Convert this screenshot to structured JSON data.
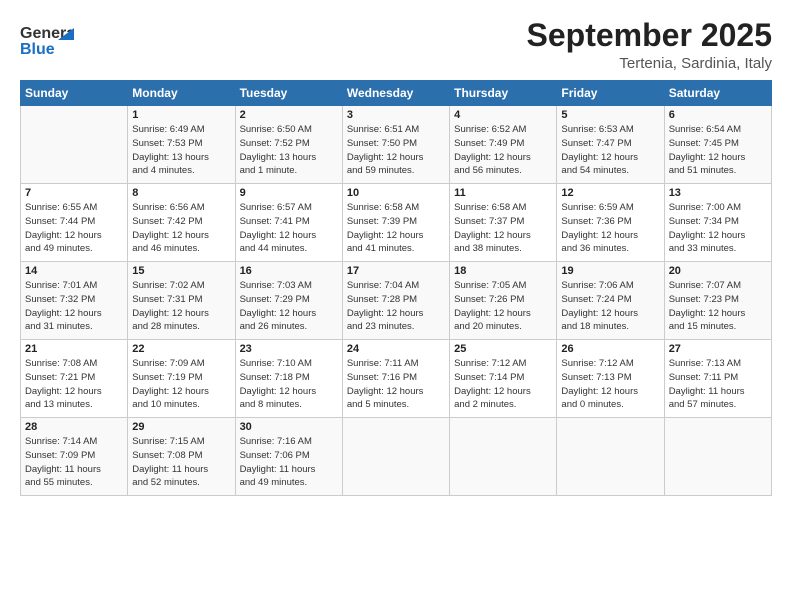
{
  "logo": {
    "line1": "General",
    "line2": "Blue"
  },
  "title": "September 2025",
  "subtitle": "Tertenia, Sardinia, Italy",
  "header_days": [
    "Sunday",
    "Monday",
    "Tuesday",
    "Wednesday",
    "Thursday",
    "Friday",
    "Saturday"
  ],
  "weeks": [
    [
      {
        "day": "",
        "info": ""
      },
      {
        "day": "1",
        "info": "Sunrise: 6:49 AM\nSunset: 7:53 PM\nDaylight: 13 hours\nand 4 minutes."
      },
      {
        "day": "2",
        "info": "Sunrise: 6:50 AM\nSunset: 7:52 PM\nDaylight: 13 hours\nand 1 minute."
      },
      {
        "day": "3",
        "info": "Sunrise: 6:51 AM\nSunset: 7:50 PM\nDaylight: 12 hours\nand 59 minutes."
      },
      {
        "day": "4",
        "info": "Sunrise: 6:52 AM\nSunset: 7:49 PM\nDaylight: 12 hours\nand 56 minutes."
      },
      {
        "day": "5",
        "info": "Sunrise: 6:53 AM\nSunset: 7:47 PM\nDaylight: 12 hours\nand 54 minutes."
      },
      {
        "day": "6",
        "info": "Sunrise: 6:54 AM\nSunset: 7:45 PM\nDaylight: 12 hours\nand 51 minutes."
      }
    ],
    [
      {
        "day": "7",
        "info": "Sunrise: 6:55 AM\nSunset: 7:44 PM\nDaylight: 12 hours\nand 49 minutes."
      },
      {
        "day": "8",
        "info": "Sunrise: 6:56 AM\nSunset: 7:42 PM\nDaylight: 12 hours\nand 46 minutes."
      },
      {
        "day": "9",
        "info": "Sunrise: 6:57 AM\nSunset: 7:41 PM\nDaylight: 12 hours\nand 44 minutes."
      },
      {
        "day": "10",
        "info": "Sunrise: 6:58 AM\nSunset: 7:39 PM\nDaylight: 12 hours\nand 41 minutes."
      },
      {
        "day": "11",
        "info": "Sunrise: 6:58 AM\nSunset: 7:37 PM\nDaylight: 12 hours\nand 38 minutes."
      },
      {
        "day": "12",
        "info": "Sunrise: 6:59 AM\nSunset: 7:36 PM\nDaylight: 12 hours\nand 36 minutes."
      },
      {
        "day": "13",
        "info": "Sunrise: 7:00 AM\nSunset: 7:34 PM\nDaylight: 12 hours\nand 33 minutes."
      }
    ],
    [
      {
        "day": "14",
        "info": "Sunrise: 7:01 AM\nSunset: 7:32 PM\nDaylight: 12 hours\nand 31 minutes."
      },
      {
        "day": "15",
        "info": "Sunrise: 7:02 AM\nSunset: 7:31 PM\nDaylight: 12 hours\nand 28 minutes."
      },
      {
        "day": "16",
        "info": "Sunrise: 7:03 AM\nSunset: 7:29 PM\nDaylight: 12 hours\nand 26 minutes."
      },
      {
        "day": "17",
        "info": "Sunrise: 7:04 AM\nSunset: 7:28 PM\nDaylight: 12 hours\nand 23 minutes."
      },
      {
        "day": "18",
        "info": "Sunrise: 7:05 AM\nSunset: 7:26 PM\nDaylight: 12 hours\nand 20 minutes."
      },
      {
        "day": "19",
        "info": "Sunrise: 7:06 AM\nSunset: 7:24 PM\nDaylight: 12 hours\nand 18 minutes."
      },
      {
        "day": "20",
        "info": "Sunrise: 7:07 AM\nSunset: 7:23 PM\nDaylight: 12 hours\nand 15 minutes."
      }
    ],
    [
      {
        "day": "21",
        "info": "Sunrise: 7:08 AM\nSunset: 7:21 PM\nDaylight: 12 hours\nand 13 minutes."
      },
      {
        "day": "22",
        "info": "Sunrise: 7:09 AM\nSunset: 7:19 PM\nDaylight: 12 hours\nand 10 minutes."
      },
      {
        "day": "23",
        "info": "Sunrise: 7:10 AM\nSunset: 7:18 PM\nDaylight: 12 hours\nand 8 minutes."
      },
      {
        "day": "24",
        "info": "Sunrise: 7:11 AM\nSunset: 7:16 PM\nDaylight: 12 hours\nand 5 minutes."
      },
      {
        "day": "25",
        "info": "Sunrise: 7:12 AM\nSunset: 7:14 PM\nDaylight: 12 hours\nand 2 minutes."
      },
      {
        "day": "26",
        "info": "Sunrise: 7:12 AM\nSunset: 7:13 PM\nDaylight: 12 hours\nand 0 minutes."
      },
      {
        "day": "27",
        "info": "Sunrise: 7:13 AM\nSunset: 7:11 PM\nDaylight: 11 hours\nand 57 minutes."
      }
    ],
    [
      {
        "day": "28",
        "info": "Sunrise: 7:14 AM\nSunset: 7:09 PM\nDaylight: 11 hours\nand 55 minutes."
      },
      {
        "day": "29",
        "info": "Sunrise: 7:15 AM\nSunset: 7:08 PM\nDaylight: 11 hours\nand 52 minutes."
      },
      {
        "day": "30",
        "info": "Sunrise: 7:16 AM\nSunset: 7:06 PM\nDaylight: 11 hours\nand 49 minutes."
      },
      {
        "day": "",
        "info": ""
      },
      {
        "day": "",
        "info": ""
      },
      {
        "day": "",
        "info": ""
      },
      {
        "day": "",
        "info": ""
      }
    ]
  ]
}
